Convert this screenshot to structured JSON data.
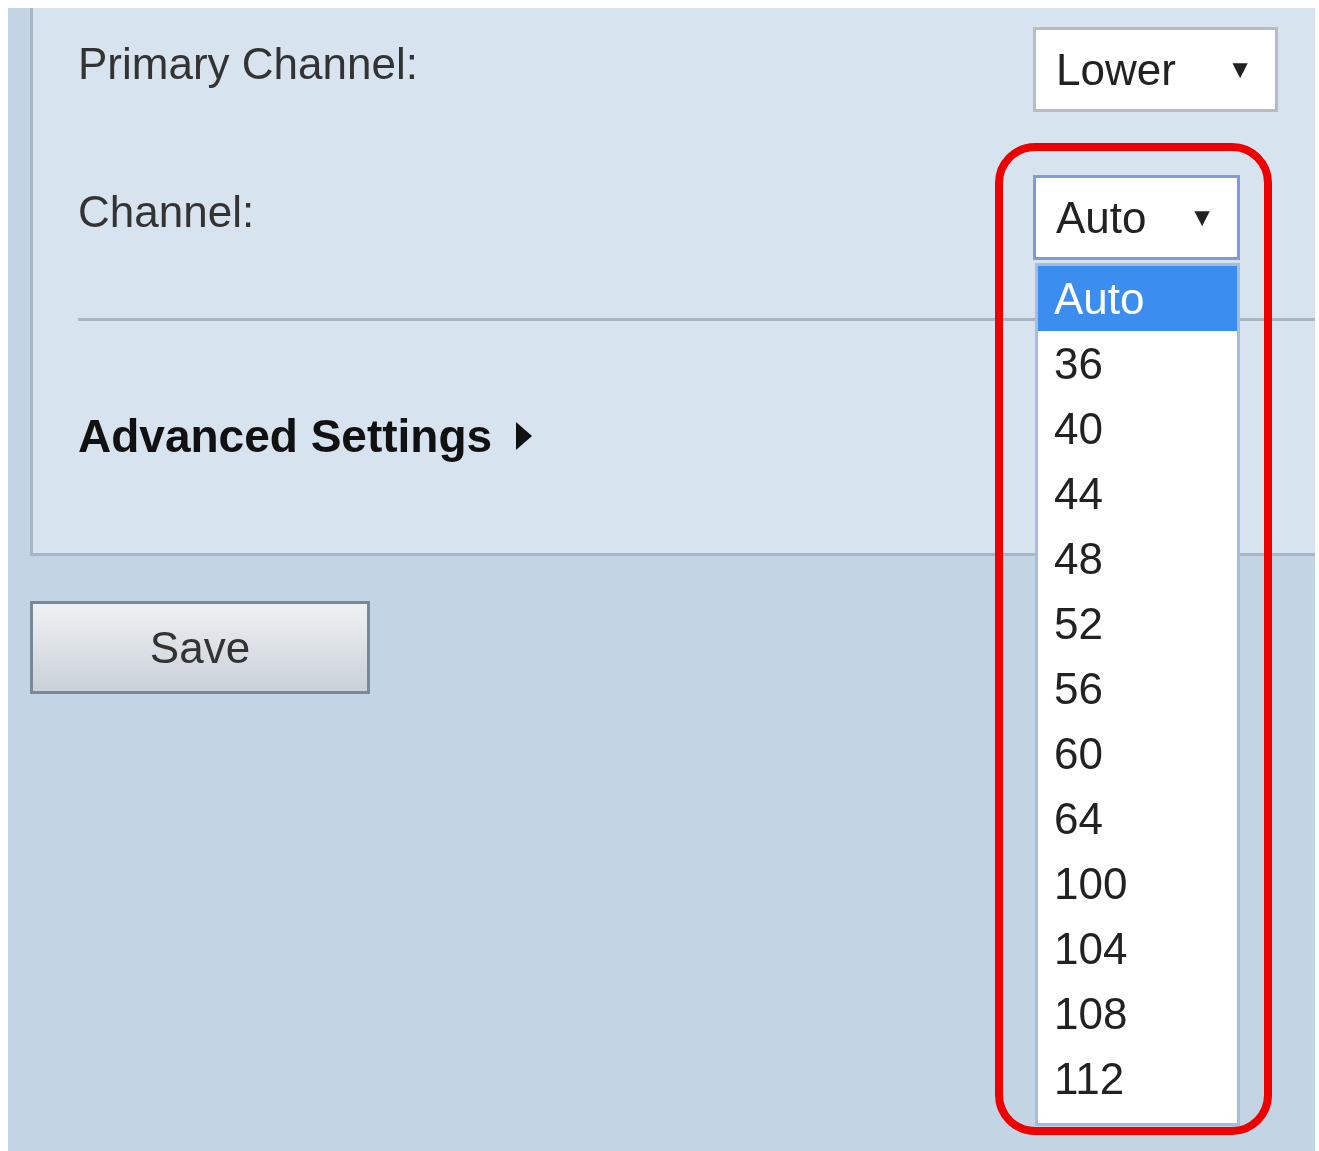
{
  "primary_channel": {
    "label": "Primary Channel:",
    "value": "Lower",
    "arrow": "▼"
  },
  "channel": {
    "label": "Channel:",
    "value": "Auto",
    "arrow": "▼",
    "expanded": true,
    "options": [
      {
        "label": "Auto",
        "selected": true
      },
      {
        "label": "36",
        "selected": false
      },
      {
        "label": "40",
        "selected": false
      },
      {
        "label": "44",
        "selected": false
      },
      {
        "label": "48",
        "selected": false
      },
      {
        "label": "52",
        "selected": false
      },
      {
        "label": "56",
        "selected": false
      },
      {
        "label": "60",
        "selected": false
      },
      {
        "label": "64",
        "selected": false
      },
      {
        "label": "100",
        "selected": false
      },
      {
        "label": "104",
        "selected": false
      },
      {
        "label": "108",
        "selected": false
      },
      {
        "label": "112",
        "selected": false
      }
    ]
  },
  "advanced_settings": {
    "label": "Advanced Settings",
    "expanded": false
  },
  "save_button": {
    "label": "Save"
  },
  "annotation": {
    "kind": "outline",
    "color": "#ee0000"
  }
}
